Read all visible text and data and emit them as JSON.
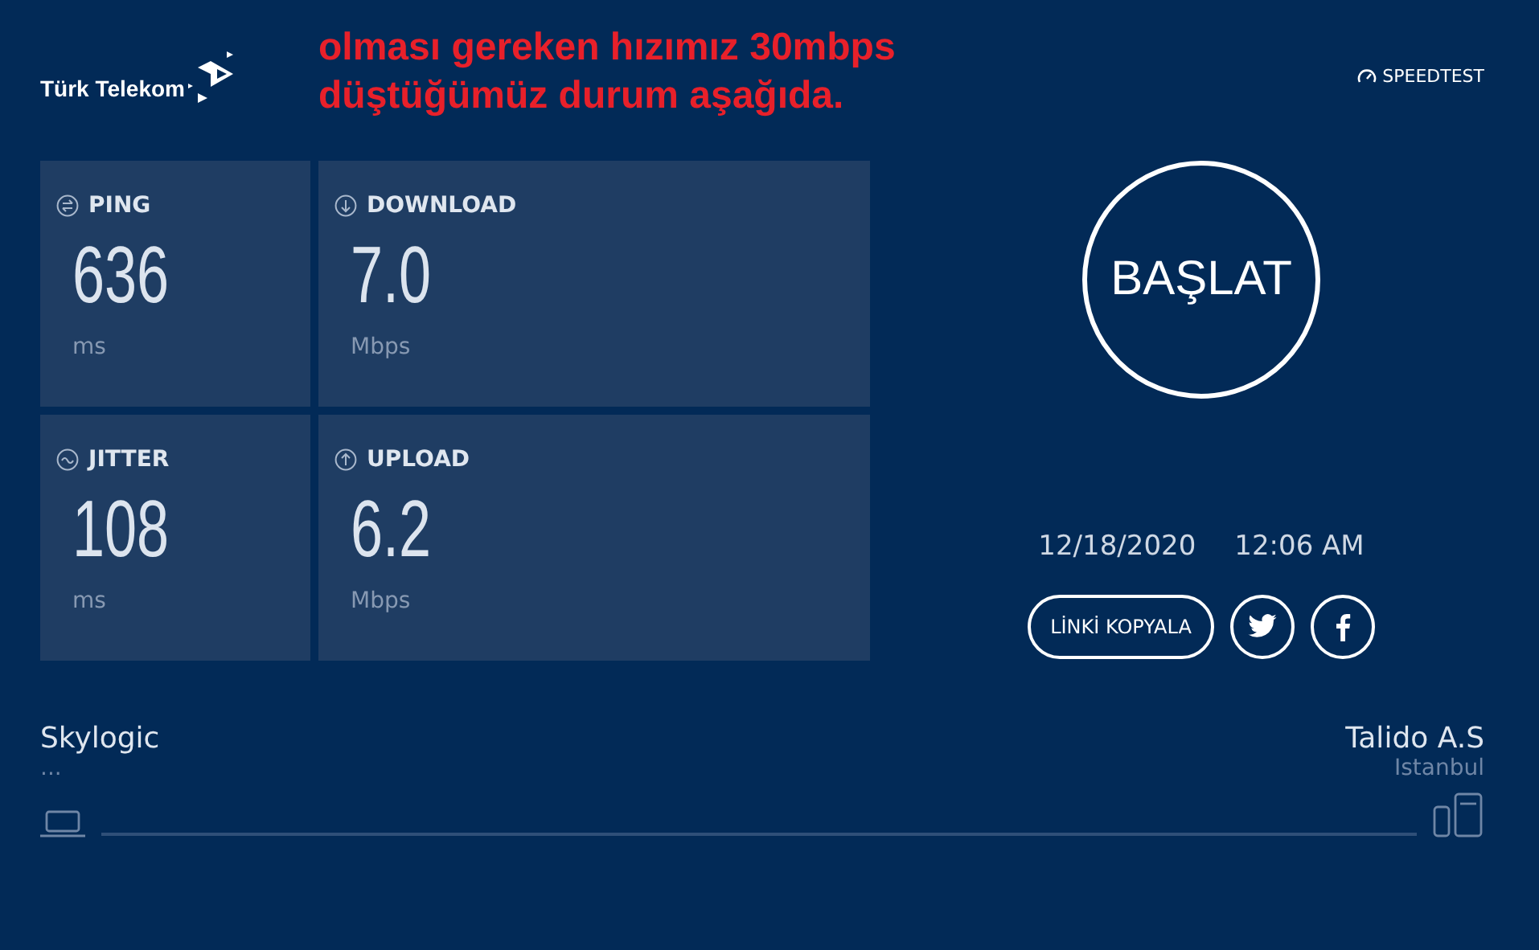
{
  "header": {
    "logo_text": "Türk Telekom",
    "note_lines": [
      "olması gereken hızımız 30mbps",
      "düştüğümüz durum aşağıda."
    ],
    "brand": "SPEEDTEST"
  },
  "metrics": [
    {
      "kind": "ping",
      "label": "PING",
      "value": "636",
      "unit": "ms"
    },
    {
      "kind": "download",
      "label": "DOWNLOAD",
      "value": "7.0",
      "unit": "Mbps"
    },
    {
      "kind": "jitter",
      "label": "JITTER",
      "value": "108",
      "unit": "ms"
    },
    {
      "kind": "upload",
      "label": "UPLOAD",
      "value": "6.2",
      "unit": "Mbps"
    }
  ],
  "start_button": "BAŞLAT",
  "date": "12/18/2020",
  "time": "12:06 AM",
  "copy_link_button": "LİNKİ KOPYALA",
  "share": [
    {
      "kind": "twitter"
    },
    {
      "kind": "facebook"
    }
  ],
  "client": {
    "name": "Skylogic",
    "detail": "..."
  },
  "server": {
    "name": "Talido A.S",
    "location": "Istanbul"
  }
}
